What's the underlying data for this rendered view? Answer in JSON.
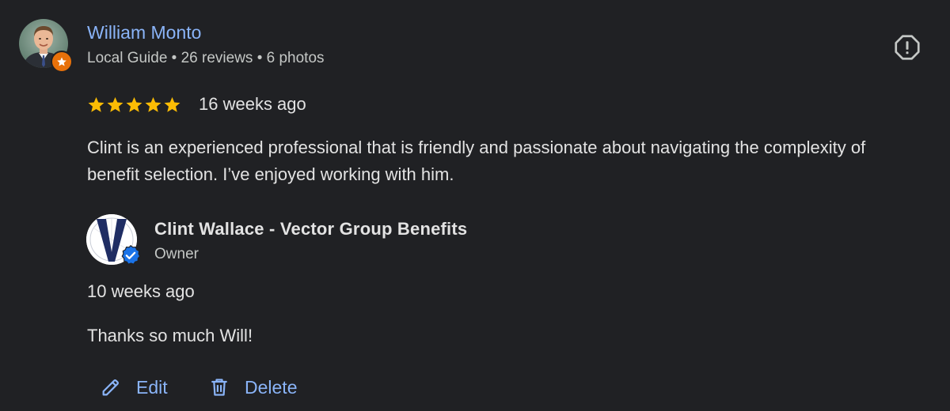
{
  "reviewer": {
    "name": "William Monto",
    "meta": "Local Guide • 26 reviews • 6 photos",
    "badge_icon": "local-guide-star-icon"
  },
  "report": {
    "icon": "report-icon"
  },
  "review": {
    "rating": 5,
    "rating_max": 5,
    "star_color": "#fbbc04",
    "time": "16 weeks ago",
    "text": "Clint is an experienced professional that is friendly and passionate about navigating the complexity of benefit selection. I’ve enjoyed working with him."
  },
  "owner_reply": {
    "name": "Clint Wallace - Vector Group Benefits",
    "role": "Owner",
    "time": "10 weeks ago",
    "text": "Thanks so much Will!",
    "badge_icon": "verified-check-icon"
  },
  "actions": {
    "edit_label": "Edit",
    "delete_label": "Delete"
  },
  "colors": {
    "background": "#202124",
    "link_blue": "#8ab4f8",
    "guide_badge": "#e8710a",
    "verified_blue": "#1a73e8"
  }
}
